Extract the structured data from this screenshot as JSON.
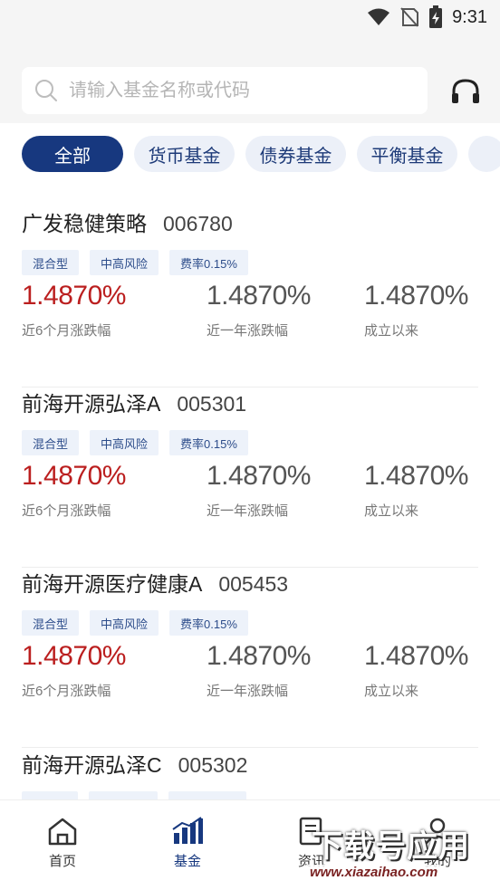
{
  "status_bar": {
    "time": "9:31"
  },
  "search": {
    "placeholder": "请输入基金名称或代码"
  },
  "tabs": [
    {
      "label": "全部",
      "active": true
    },
    {
      "label": "货币基金"
    },
    {
      "label": "债券基金"
    },
    {
      "label": "平衡基金"
    }
  ],
  "funds": [
    {
      "name": "广发稳健策略",
      "code": "006780",
      "tags": [
        "混合型",
        "中高风险",
        "费率0.15%"
      ],
      "six_month": "1.4870%",
      "one_year": "1.4870%",
      "since_inception": "1.4870%"
    },
    {
      "name": "前海开源弘泽A",
      "code": "005301",
      "tags": [
        "混合型",
        "中高风险",
        "费率0.15%"
      ],
      "six_month": "1.4870%",
      "one_year": "1.4870%",
      "since_inception": "1.4870%"
    },
    {
      "name": "前海开源医疗健康A",
      "code": "005453",
      "tags": [
        "混合型",
        "中高风险",
        "费率0.15%"
      ],
      "six_month": "1.4870%",
      "one_year": "1.4870%",
      "since_inception": "1.4870%"
    },
    {
      "name": "前海开源弘泽C",
      "code": "005302"
    }
  ],
  "labels": {
    "six_month": "近6个月涨跌幅",
    "one_year": "近一年涨跌幅",
    "since_inception": "成立以来"
  },
  "bottom_nav": [
    {
      "label": "首页",
      "icon": "home-icon"
    },
    {
      "label": "基金",
      "icon": "chart-bars-icon",
      "active": true
    },
    {
      "label": "资讯",
      "icon": "news-icon"
    },
    {
      "label": "我的",
      "icon": "user-icon"
    }
  ],
  "watermark": {
    "title": "下载号应用",
    "url": "www.xiazaihao.com"
  },
  "colors": {
    "primary": "#17387f",
    "gain": "#bb1f1f",
    "tag_bg": "#edf2fa"
  }
}
